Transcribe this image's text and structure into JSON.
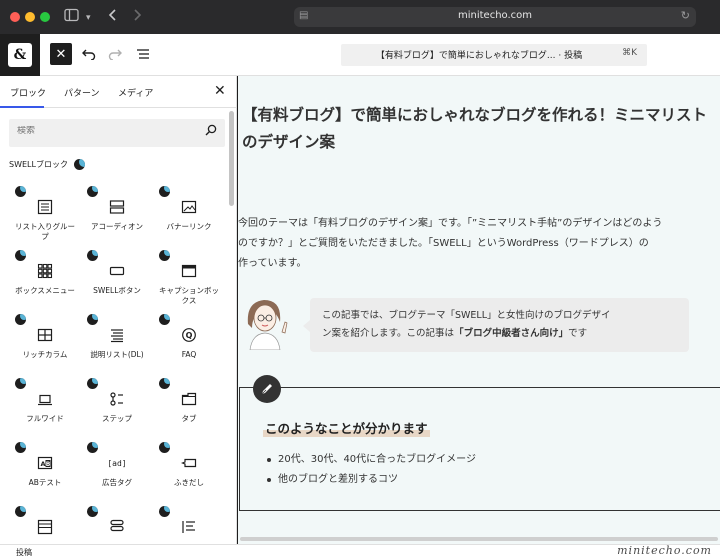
{
  "browser": {
    "url": "minitecho.com"
  },
  "toolbar": {
    "document_title": "【有料ブログ】で簡単におしゃれなブログ... · 投稿",
    "shortcut": "⌘K"
  },
  "inserter": {
    "tabs": [
      {
        "label": "ブロック"
      },
      {
        "label": "パターン"
      },
      {
        "label": "メディア"
      }
    ],
    "search_placeholder": "検索",
    "category": "SWELLブロック",
    "blocks": [
      {
        "label": "リスト入りグループ",
        "icon": "list-box-icon"
      },
      {
        "label": "アコーディオン",
        "icon": "accordion-icon"
      },
      {
        "label": "バナーリンク",
        "icon": "image-icon"
      },
      {
        "label": "ボックスメニュー",
        "icon": "grid-icon"
      },
      {
        "label": "SWELLボタン",
        "icon": "button-icon"
      },
      {
        "label": "キャプションボックス",
        "icon": "caption-box-icon"
      },
      {
        "label": "リッチカラム",
        "icon": "columns-icon"
      },
      {
        "label": "説明リスト(DL)",
        "icon": "dl-list-icon"
      },
      {
        "label": "FAQ",
        "icon": "faq-icon"
      },
      {
        "label": "フルワイド",
        "icon": "fullwide-icon"
      },
      {
        "label": "ステップ",
        "icon": "step-icon"
      },
      {
        "label": "タブ",
        "icon": "tab-icon"
      },
      {
        "label": "ABテスト",
        "icon": "ab-test-icon"
      },
      {
        "label": "広告タグ",
        "icon": "ad-tag-icon"
      },
      {
        "label": "ふきだし",
        "icon": "balloon-icon"
      },
      {
        "label": "",
        "icon": "post-list-icon"
      },
      {
        "label": "",
        "icon": "stack-icon"
      },
      {
        "label": "",
        "icon": "toc-icon"
      }
    ]
  },
  "post": {
    "title": "【有料ブログ】で簡単におしゃれなブログを作れる！ミニマリスト\nのデザイン案",
    "intro": "今回のテーマは「有料ブログのデザイン案」です。「”ミニマリスト手帖”のデザインはどのよう\nのですか？」とご質問をいただきました。「SWELL」というWordPress（ワードプレス）の\n作っています。",
    "balloon_text_1": "この記事では、ブログテーマ「SWELL」と女性向けのブログデザイ",
    "balloon_text_2": "ン案を紹介します。この記事は",
    "balloon_text_bold": "「ブログ中級者さん向け」",
    "balloon_text_3": "です",
    "box_title": "このようなことが分かります",
    "box_items": [
      "20代、30代、40代に合ったブログイメージ",
      "他のブログと差別するコツ"
    ]
  },
  "status": {
    "breadcrumb": "投稿",
    "watermark": "minitecho.com"
  },
  "colors": {
    "accent": "#3858e9",
    "canvas_bg": "#f2f8f8",
    "marker": "#e8d7c6"
  }
}
